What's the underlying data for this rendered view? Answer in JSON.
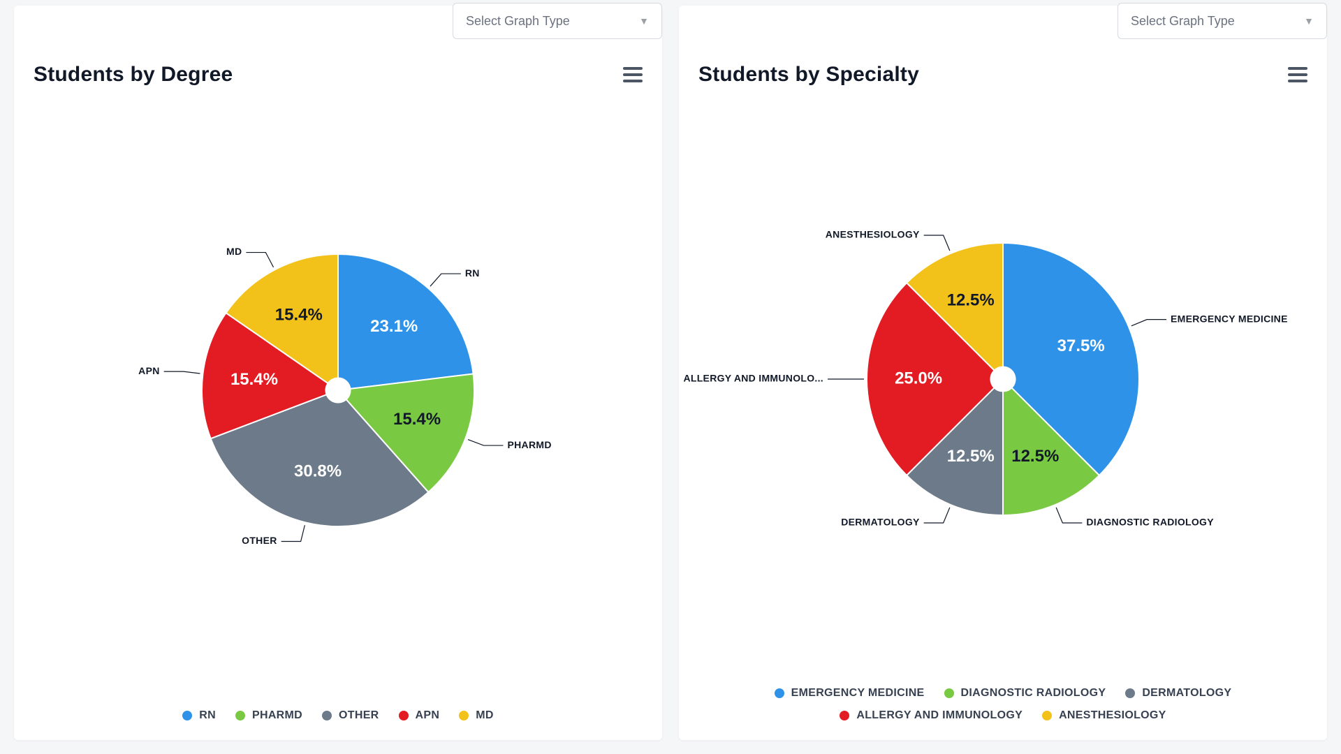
{
  "colors": {
    "blue": "#2E93E8",
    "green": "#7AC943",
    "gray": "#6C7A89",
    "red": "#E31B23",
    "yellow": "#F2C21A",
    "text": "#111827",
    "white": "#FFFFFF"
  },
  "select_placeholder": "Select Graph Type",
  "left": {
    "title": "Students by Degree",
    "legend_order": [
      "RN",
      "PHARMD",
      "OTHER",
      "APN",
      "MD"
    ]
  },
  "right": {
    "title": "Students by Specialty",
    "legend_order": [
      "EMERGENCY MEDICINE",
      "DIAGNOSTIC RADIOLOGY",
      "DERMATOLOGY",
      "ALLERGY AND IMMUNOLOGY",
      "ANESTHESIOLOGY"
    ]
  },
  "chart_data": [
    {
      "type": "pie",
      "title": "Students by Degree",
      "series": [
        {
          "name": "RN",
          "value": 23.1,
          "color": "blue"
        },
        {
          "name": "PHARMD",
          "value": 15.4,
          "color": "green"
        },
        {
          "name": "OTHER",
          "value": 30.8,
          "color": "gray"
        },
        {
          "name": "APN",
          "value": 15.4,
          "color": "red"
        },
        {
          "name": "MD",
          "value": 15.4,
          "color": "yellow"
        }
      ],
      "donut_inner_radius_pct": 9
    },
    {
      "type": "pie",
      "title": "Students by Specialty",
      "series": [
        {
          "name": "EMERGENCY MEDICINE",
          "value": 37.5,
          "color": "blue"
        },
        {
          "name": "DIAGNOSTIC RADIOLOGY",
          "value": 12.5,
          "color": "green"
        },
        {
          "name": "DERMATOLOGY",
          "value": 12.5,
          "color": "gray"
        },
        {
          "name": "ALLERGY AND IMMUNOLOGY",
          "value": 25.0,
          "color": "red"
        },
        {
          "name": "ANESTHESIOLOGY",
          "value": 12.5,
          "color": "yellow"
        }
      ],
      "donut_inner_radius_pct": 9,
      "label_truncate": {
        "ALLERGY AND IMMUNOLOGY": "ALLERGY AND IMMUNOLO..."
      }
    }
  ]
}
